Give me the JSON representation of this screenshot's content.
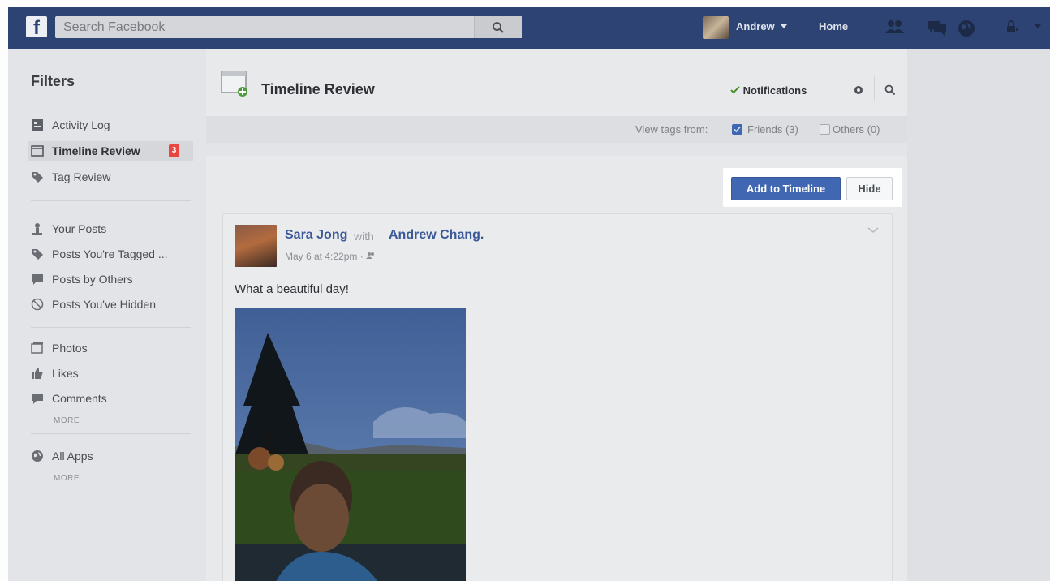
{
  "topbar": {
    "logo": "f",
    "search_placeholder": "Search Facebook",
    "user_name": "Andrew",
    "home_label": "Home"
  },
  "sidebar": {
    "title": "Filters",
    "items": [
      {
        "label": "Activity Log"
      },
      {
        "label": "Timeline Review",
        "badge": "3"
      },
      {
        "label": "Tag Review"
      },
      {
        "label": "Your Posts"
      },
      {
        "label": "Posts You're Tagged ..."
      },
      {
        "label": "Posts by Others"
      },
      {
        "label": "Posts You've Hidden"
      },
      {
        "label": "Photos"
      },
      {
        "label": "Likes"
      },
      {
        "label": "Comments"
      },
      {
        "label": "All Apps"
      }
    ],
    "more_1": "MORE",
    "more_2": "MORE"
  },
  "header": {
    "title": "Timeline Review",
    "notifications_label": "Notifications"
  },
  "filter_bar": {
    "view_tags_label": "View tags from:",
    "friends_label": "Friends (3)",
    "others_label": "Others (0)"
  },
  "actions": {
    "add_label": "Add to Timeline",
    "hide_label": "Hide"
  },
  "post": {
    "author": "Sara Jong",
    "with_word": "with",
    "tagged": "Andrew Chang.",
    "meta": "May 6 at 4:22pm · ",
    "text": "What a beautiful day!"
  },
  "colors": {
    "topbar": "#2d4373",
    "primary_button": "#4267b2",
    "link": "#3b5998",
    "badge": "#e8463f"
  }
}
